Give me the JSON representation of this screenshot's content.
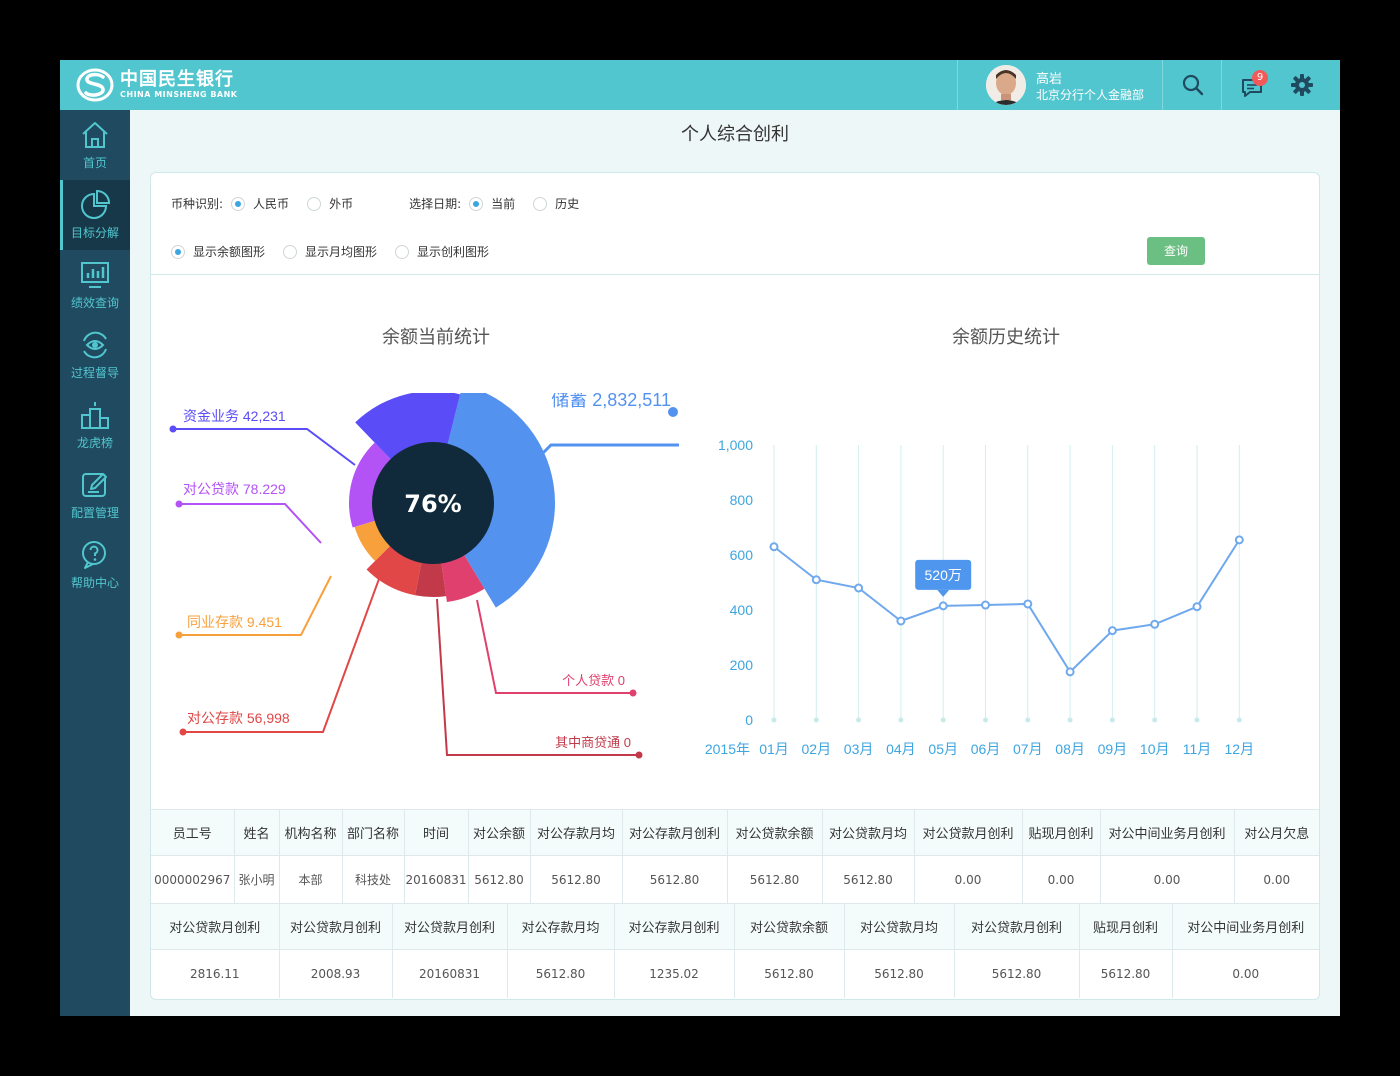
{
  "header": {
    "logo_cn": "中国民生银行",
    "logo_en": "CHINA MINSHENG BANK",
    "user_name": "高岩",
    "user_dept": "北京分行个人金融部",
    "message_count": "9"
  },
  "sidebar": {
    "items": [
      {
        "label": "首页",
        "icon": "home-icon"
      },
      {
        "label": "目标分解",
        "icon": "pie-chart-icon"
      },
      {
        "label": "绩效查询",
        "icon": "monitor-chart-icon"
      },
      {
        "label": "过程督导",
        "icon": "eye-cycle-icon"
      },
      {
        "label": "龙虎榜",
        "icon": "podium-icon"
      },
      {
        "label": "配置管理",
        "icon": "edit-icon"
      },
      {
        "label": "帮助中心",
        "icon": "help-chat-icon"
      }
    ]
  },
  "page": {
    "title": "个人综合创利"
  },
  "filters": {
    "currency_label": "币种识别:",
    "currency_options": [
      "人民币",
      "外币"
    ],
    "date_label": "选择日期:",
    "date_options": [
      "当前",
      "历史"
    ],
    "display_options": [
      "显示余额图形",
      "显示月均图形",
      "显示创利图形"
    ],
    "query_button": "查询"
  },
  "chart_data": [
    {
      "type": "pie",
      "title": "余额当前统计",
      "center_label": "76%",
      "slices": [
        {
          "name": "储蓄",
          "label": "2,832,511",
          "color": "#5492f0"
        },
        {
          "name": "个人贷款",
          "label": "0",
          "color": "#e0406e"
        },
        {
          "name": "其中商贷通",
          "label": "0",
          "color": "#c23a4a"
        },
        {
          "name": "对公存款",
          "label": "56,998",
          "color": "#e14747"
        },
        {
          "name": "同业存款",
          "label": "9.451",
          "color": "#f7a03c"
        },
        {
          "name": "对公贷款",
          "label": "78.229",
          "color": "#b352f5"
        },
        {
          "name": "资金业务",
          "label": "42,231",
          "color": "#5a4cf6"
        }
      ]
    },
    {
      "type": "line",
      "title": "余额历史统计",
      "year_label": "2015年",
      "categories": [
        "01月",
        "02月",
        "03月",
        "04月",
        "05月",
        "06月",
        "07月",
        "08月",
        "09月",
        "10月",
        "11月",
        "12月"
      ],
      "values": [
        630,
        510,
        480,
        360,
        415,
        418,
        422,
        175,
        325,
        348,
        412,
        655
      ],
      "ylim": [
        0,
        1000
      ],
      "yticks": [
        "0",
        "200",
        "400",
        "600",
        "800",
        "1,000"
      ],
      "tooltip": {
        "index": 4,
        "text": "520万"
      },
      "color": "#6fa8ec"
    }
  ],
  "table1": {
    "headers": [
      "员工号",
      "姓名",
      "机构名称",
      "部门名称",
      "时间",
      "对公余额",
      "对公存款月均",
      "对公存款月创利",
      "对公贷款余额",
      "对公贷款月均",
      "对公贷款月创利",
      "贴现月创利",
      "对公中间业务月创利",
      "对公月欠息"
    ],
    "rows": [
      [
        "0000002967",
        "张小明",
        "本部",
        "科技处",
        "20160831",
        "5612.80",
        "5612.80",
        "5612.80",
        "5612.80",
        "5612.80",
        "0.00",
        "0.00",
        "0.00",
        "0.00"
      ]
    ]
  },
  "table2": {
    "headers": [
      "对公贷款月创利",
      "对公贷款月创利",
      "对公贷款月创利",
      "对公存款月均",
      "对公存款月创利",
      "对公贷款余额",
      "对公贷款月均",
      "对公贷款月创利",
      "贴现月创利",
      "对公中间业务月创利"
    ],
    "rows": [
      [
        "2816.11",
        "2008.93",
        "20160831",
        "5612.80",
        "1235.02",
        "5612.80",
        "5612.80",
        "5612.80",
        "5612.80",
        "0.00"
      ]
    ]
  }
}
